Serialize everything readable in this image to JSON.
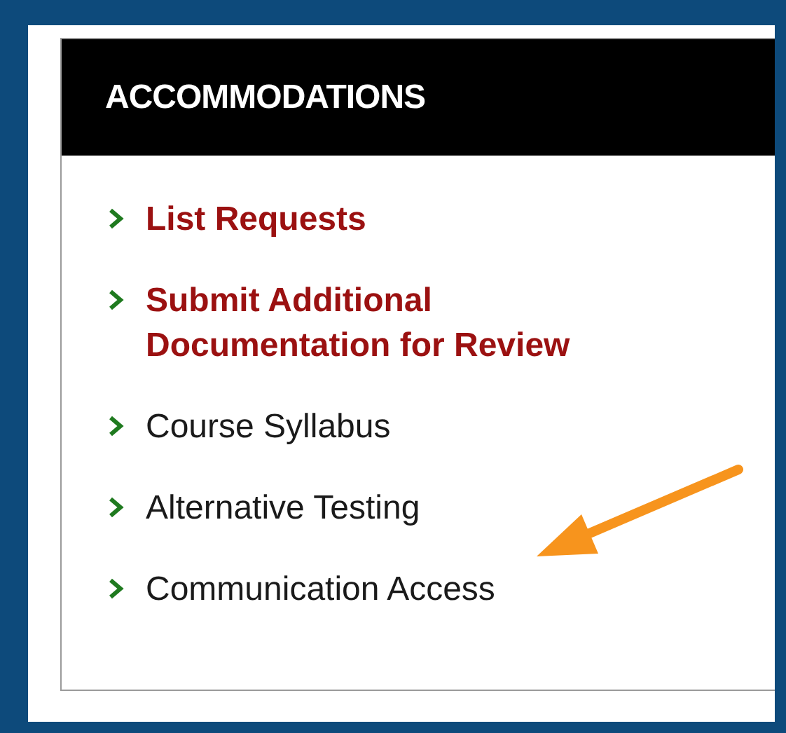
{
  "panel": {
    "title": "ACCOMMODATIONS"
  },
  "items": [
    {
      "label": "List Requests",
      "kind": "highlight"
    },
    {
      "label": "Submit Additional Documentation for Review",
      "kind": "highlight"
    },
    {
      "label": "Course Syllabus",
      "kind": "normal"
    },
    {
      "label": "Alternative Testing",
      "kind": "normal"
    },
    {
      "label": "Communication Access",
      "kind": "normal"
    }
  ]
}
